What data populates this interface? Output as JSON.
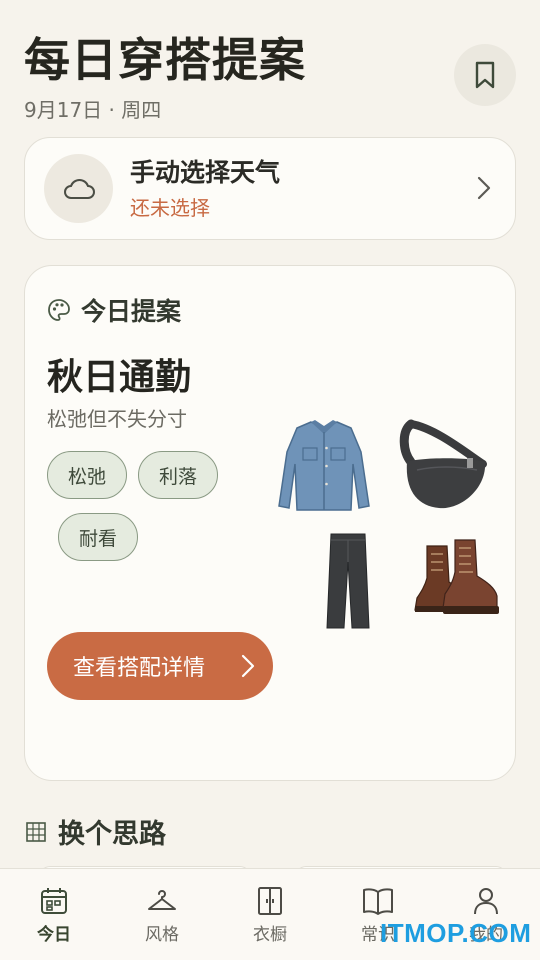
{
  "header": {
    "title": "每日穿搭提案",
    "date": "9月17日 · 周四",
    "bookmark_icon": "bookmark-icon"
  },
  "weather": {
    "title": "手动选择天气",
    "status": "还未选择",
    "icon": "cloud-icon"
  },
  "proposal": {
    "section_label": "今日提案",
    "outfit_name": "秋日通勤",
    "outfit_desc": "松弛但不失分寸",
    "tags": [
      "松弛",
      "利落",
      "耐看"
    ],
    "cta_label": "查看搭配详情",
    "items": [
      "denim-shirt",
      "crossbody-bag",
      "wide-leg-trousers",
      "lace-up-boots"
    ]
  },
  "alternatives": {
    "section_label": "换个思路"
  },
  "tabbar": {
    "tabs": [
      {
        "label": "今日",
        "icon": "calendar-icon",
        "active": true
      },
      {
        "label": "风格",
        "icon": "hanger-icon",
        "active": false
      },
      {
        "label": "衣橱",
        "icon": "wardrobe-icon",
        "active": false
      },
      {
        "label": "常识",
        "icon": "book-icon",
        "active": false
      },
      {
        "label": "我的",
        "icon": "user-icon",
        "active": false
      }
    ]
  },
  "watermark": "ITMOP.COM",
  "colors": {
    "accent": "#c96b44",
    "tag_bg": "#e5ebdf",
    "background": "#f6f3ec"
  }
}
